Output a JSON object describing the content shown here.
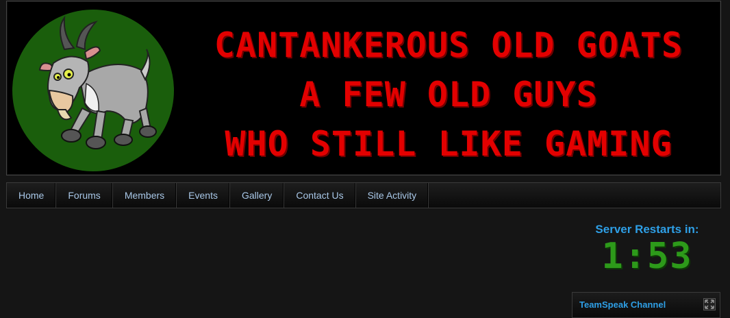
{
  "banner": {
    "line1": "CANTANKEROUS OLD GOATS",
    "line2": "A FEW OLD GUYS",
    "line3": "WHO STILL LIKE GAMING",
    "logo_icon": "goat-logo-icon",
    "text_color": "#e30000",
    "logo_bg_color": "#1a5e0c"
  },
  "nav": {
    "items": [
      "Home",
      "Forums",
      "Members",
      "Events",
      "Gallery",
      "Contact Us",
      "Site Activity"
    ]
  },
  "server_restart": {
    "label": "Server Restarts in:",
    "time": "1:53",
    "label_color": "#2e9fe6",
    "time_color": "#2d9a1a"
  },
  "teamspeak": {
    "title": "TeamSpeak Channel",
    "expand_icon": "expand-icon"
  }
}
